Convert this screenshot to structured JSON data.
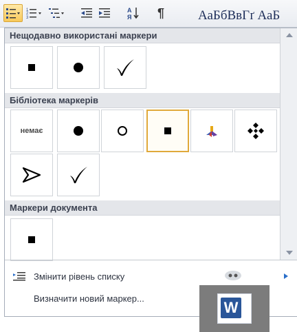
{
  "ribbon": {
    "styles_preview": "АаБбВвГґ  АаБ",
    "pilcrow": "¶",
    "sort_label": "А↓"
  },
  "bullet_library_panel": {
    "recent": {
      "header": "Нещодавно використані маркери",
      "items": [
        {
          "icon": "square-bullet-icon"
        },
        {
          "icon": "circle-bullet-icon"
        },
        {
          "icon": "checkmark-bullet-icon"
        }
      ]
    },
    "library": {
      "header": "Бібліотека маркерів",
      "none_label": "немає",
      "selected_item": "square-bullet",
      "items": [
        {
          "icon": "none"
        },
        {
          "icon": "circle-bullet-icon"
        },
        {
          "icon": "hollow-circle-bullet-icon"
        },
        {
          "icon": "square-bullet-icon"
        },
        {
          "icon": "color-shape-bullet-icon"
        },
        {
          "icon": "diamond-cluster-bullet-icon"
        },
        {
          "icon": "arrow-bullet-icon"
        },
        {
          "icon": "checkmark-bullet-icon"
        }
      ]
    },
    "document": {
      "header": "Маркери документа",
      "items": [
        {
          "icon": "square-bullet-icon"
        }
      ]
    },
    "menu": {
      "change_level": "Змінити рівень списку",
      "define_new": "Визначити новий маркер..."
    }
  },
  "taskbar": {
    "word_icon_letter": "W"
  }
}
